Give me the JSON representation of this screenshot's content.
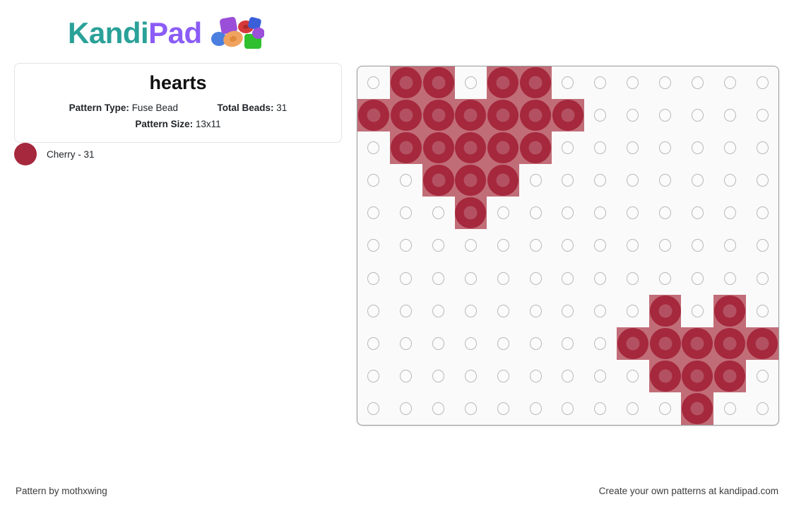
{
  "brand": {
    "name_part1": "Kandi",
    "name_part2": "Pad",
    "logo_icon": "bead-cluster-icon",
    "color_teal": "#2aa198",
    "color_purple": "#8b5cf6"
  },
  "info_card": {
    "title": "hearts",
    "pattern_type_label": "Pattern Type:",
    "pattern_type_value": "Fuse Bead",
    "total_beads_label": "Total Beads:",
    "total_beads_value": "31",
    "pattern_size_label": "Pattern Size:",
    "pattern_size_value": "13x11"
  },
  "legend": {
    "items": [
      {
        "name": "Cherry",
        "count": 31,
        "label": "Cherry - 31",
        "color": "#a5283c"
      }
    ]
  },
  "grid": {
    "columns": 13,
    "rows": 11,
    "empty_hole_color": "#b9b9b9",
    "bead_color": "#a5283c",
    "bead_inner_color": "#b35162",
    "background": "#fafafa",
    "cells": [
      [
        0,
        1,
        1,
        0,
        1,
        1,
        0,
        0,
        0,
        0,
        0,
        0,
        0
      ],
      [
        1,
        1,
        1,
        1,
        1,
        1,
        1,
        0,
        0,
        0,
        0,
        0,
        0
      ],
      [
        0,
        1,
        1,
        1,
        1,
        1,
        0,
        0,
        0,
        0,
        0,
        0,
        0
      ],
      [
        0,
        0,
        1,
        1,
        1,
        0,
        0,
        0,
        0,
        0,
        0,
        0,
        0
      ],
      [
        0,
        0,
        0,
        1,
        0,
        0,
        0,
        0,
        0,
        0,
        0,
        0,
        0
      ],
      [
        0,
        0,
        0,
        0,
        0,
        0,
        0,
        0,
        0,
        0,
        0,
        0,
        0
      ],
      [
        0,
        0,
        0,
        0,
        0,
        0,
        0,
        0,
        0,
        0,
        0,
        0,
        0
      ],
      [
        0,
        0,
        0,
        0,
        0,
        0,
        0,
        0,
        0,
        1,
        0,
        1,
        0
      ],
      [
        0,
        0,
        0,
        0,
        0,
        0,
        0,
        0,
        1,
        1,
        1,
        1,
        1
      ],
      [
        0,
        0,
        0,
        0,
        0,
        0,
        0,
        0,
        0,
        1,
        1,
        1,
        0
      ],
      [
        0,
        0,
        0,
        0,
        0,
        0,
        0,
        0,
        0,
        0,
        1,
        0,
        0
      ]
    ]
  },
  "footer": {
    "credit": "Pattern by mothxwing",
    "promo": "Create your own patterns at kandipad.com"
  }
}
